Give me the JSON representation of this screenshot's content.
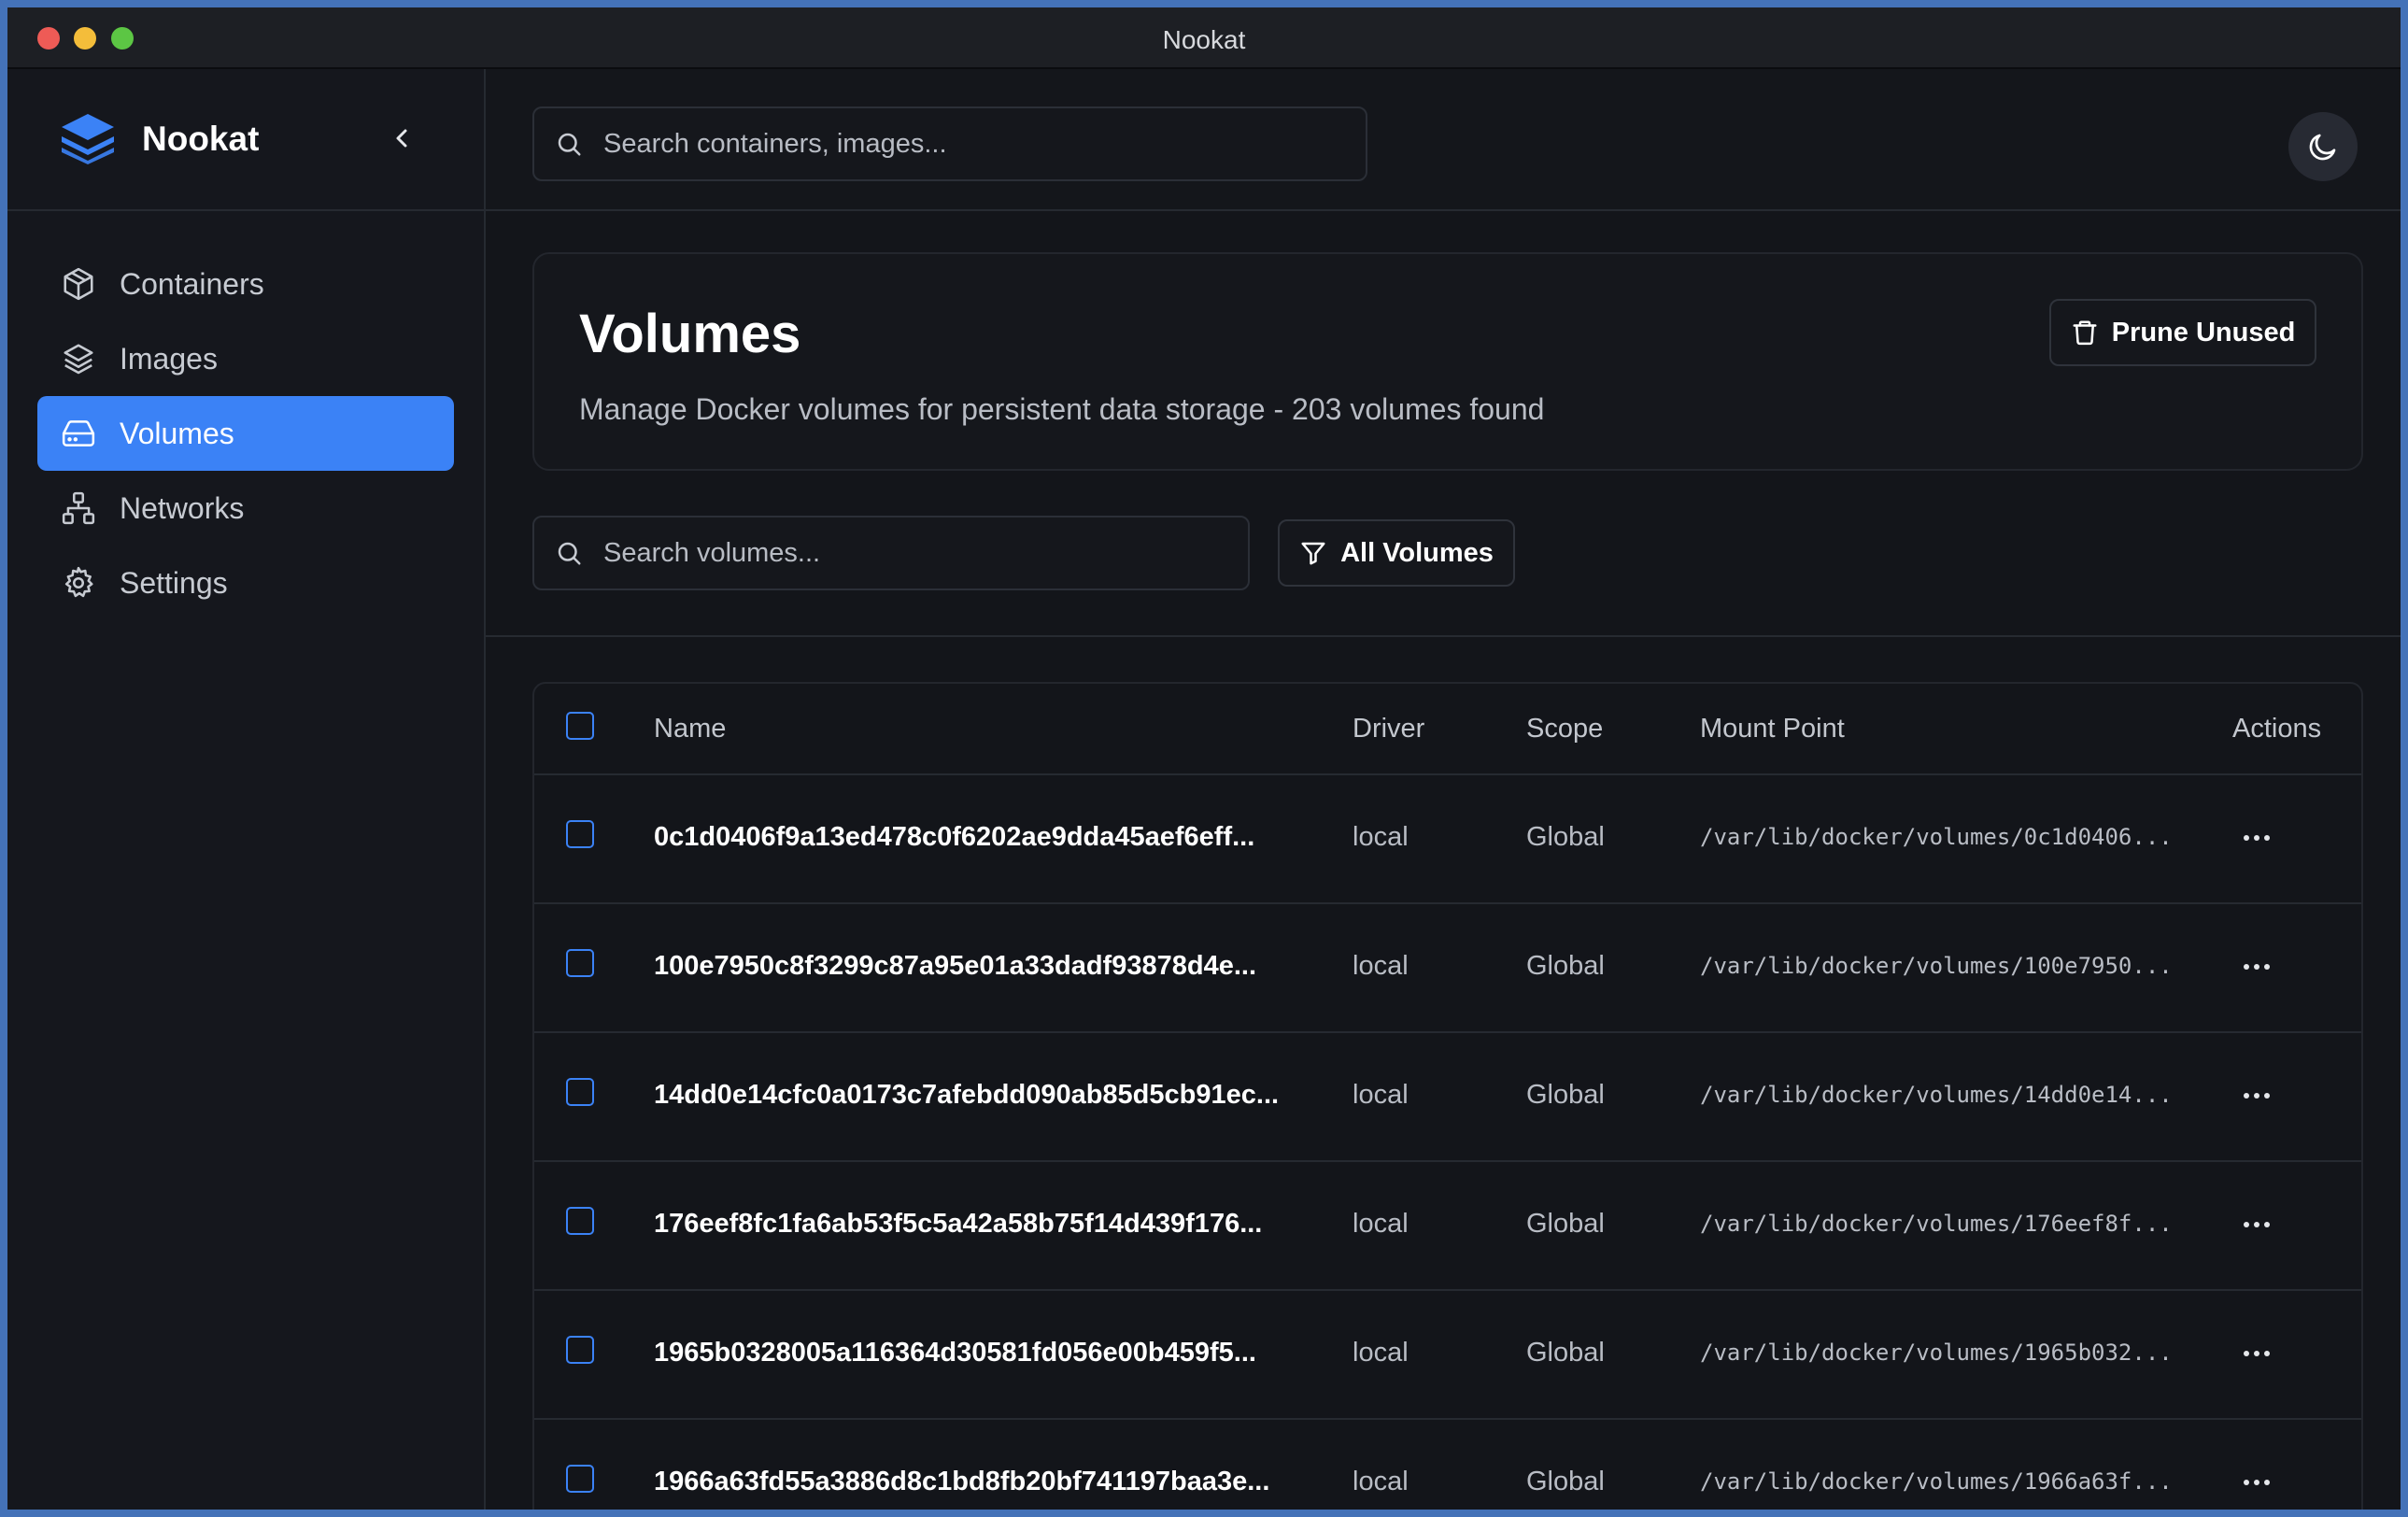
{
  "window": {
    "title": "Nookat"
  },
  "sidebar": {
    "brand": "Nookat",
    "items": [
      {
        "label": "Containers",
        "icon": "box-icon",
        "active": false
      },
      {
        "label": "Images",
        "icon": "layers-icon",
        "active": false
      },
      {
        "label": "Volumes",
        "icon": "hard-drive-icon",
        "active": true
      },
      {
        "label": "Networks",
        "icon": "network-icon",
        "active": false
      },
      {
        "label": "Settings",
        "icon": "gear-icon",
        "active": false
      }
    ]
  },
  "topbar": {
    "search_placeholder": "Search containers, images..."
  },
  "header": {
    "title": "Volumes",
    "subtitle": "Manage Docker volumes for persistent data storage - 203 volumes found",
    "prune_label": "Prune Unused"
  },
  "filters": {
    "search_placeholder": "Search volumes...",
    "filter_label": "All Volumes"
  },
  "table": {
    "columns": {
      "name": "Name",
      "driver": "Driver",
      "scope": "Scope",
      "mount": "Mount Point",
      "actions": "Actions"
    },
    "rows": [
      {
        "name": "0c1d0406f9a13ed478c0f6202ae9dda45aef6eff...",
        "driver": "local",
        "scope": "Global",
        "mount": "/var/lib/docker/volumes/0c1d0406..."
      },
      {
        "name": "100e7950c8f3299c87a95e01a33dadf93878d4e...",
        "driver": "local",
        "scope": "Global",
        "mount": "/var/lib/docker/volumes/100e7950..."
      },
      {
        "name": "14dd0e14cfc0a0173c7afebdd090ab85d5cb91ec...",
        "driver": "local",
        "scope": "Global",
        "mount": "/var/lib/docker/volumes/14dd0e14..."
      },
      {
        "name": "176eef8fc1fa6ab53f5c5a42a58b75f14d439f176...",
        "driver": "local",
        "scope": "Global",
        "mount": "/var/lib/docker/volumes/176eef8f..."
      },
      {
        "name": "1965b0328005a116364d30581fd056e00b459f5...",
        "driver": "local",
        "scope": "Global",
        "mount": "/var/lib/docker/volumes/1965b032..."
      },
      {
        "name": "1966a63fd55a3886d8c1bd8fb20bf741197baa3e...",
        "driver": "local",
        "scope": "Global",
        "mount": "/var/lib/docker/volumes/1966a63f..."
      }
    ]
  },
  "colors": {
    "accent": "#3b82f6",
    "background": "#13151a",
    "sidebar": "#15171d"
  }
}
